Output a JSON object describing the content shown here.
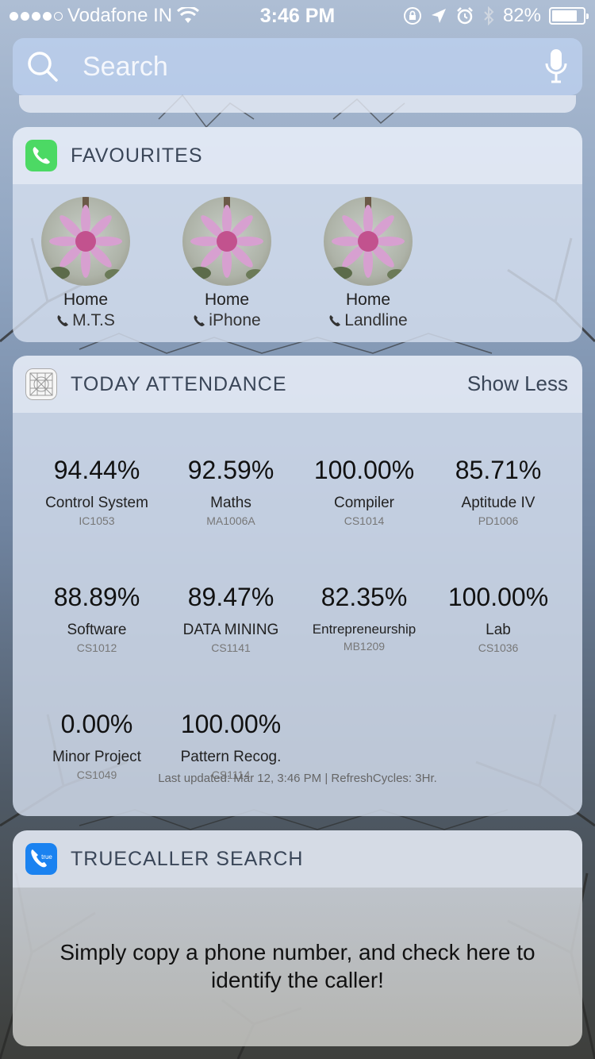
{
  "status_bar": {
    "carrier": "Vodafone IN",
    "time": "3:46 PM",
    "battery": "82%",
    "battery_level": 0.82,
    "signal_bars": 4,
    "signal_max": 5
  },
  "search": {
    "placeholder": "Search"
  },
  "favourites": {
    "title": "FAVOURITES",
    "contacts": [
      {
        "name": "Home",
        "label": "M.T.S"
      },
      {
        "name": "Home",
        "label": "iPhone"
      },
      {
        "name": "Home",
        "label": "Landline"
      }
    ]
  },
  "attendance": {
    "title": "TODAY ATTENDANCE",
    "show_less": "Show Less",
    "subjects": [
      {
        "percent": "94.44%",
        "name": "Control System",
        "code": "IC1053"
      },
      {
        "percent": "92.59%",
        "name": "Maths",
        "code": "MA1006A"
      },
      {
        "percent": "100.00%",
        "name": "Compiler",
        "code": "CS1014"
      },
      {
        "percent": "85.71%",
        "name": "Aptitude IV",
        "code": "PD1006"
      },
      {
        "percent": "88.89%",
        "name": "Software",
        "code": "CS1012"
      },
      {
        "percent": "89.47%",
        "name": "DATA MINING",
        "code": "CS1141"
      },
      {
        "percent": "82.35%",
        "name": "Entrepreneurship",
        "code": "MB1209"
      },
      {
        "percent": "100.00%",
        "name": "Lab",
        "code": "CS1036"
      },
      {
        "percent": "0.00%",
        "name": "Minor Project",
        "code": "CS1049"
      },
      {
        "percent": "100.00%",
        "name": "Pattern Recog.",
        "code": "CS1114"
      }
    ],
    "last_updated": "Last updated: Mar 12, 3:46 PM | RefreshCycles: 3Hr."
  },
  "truecaller": {
    "title": "TRUECALLER SEARCH",
    "icon_text": "true",
    "message": "Simply copy a phone number, and check here to identify the caller!"
  },
  "colors": {
    "phone_app_green": "#4cd964",
    "truecaller_blue": "#1a82f0",
    "widget_header": "#e8eef8",
    "title_text": "#3a4658"
  },
  "icons": {
    "search": "search-icon",
    "mic": "microphone-icon",
    "phone_app": "phone-app-icon",
    "attendance_app": "attendance-app-icon",
    "truecaller_app": "truecaller-app-icon",
    "phone_small": "phone-icon"
  }
}
